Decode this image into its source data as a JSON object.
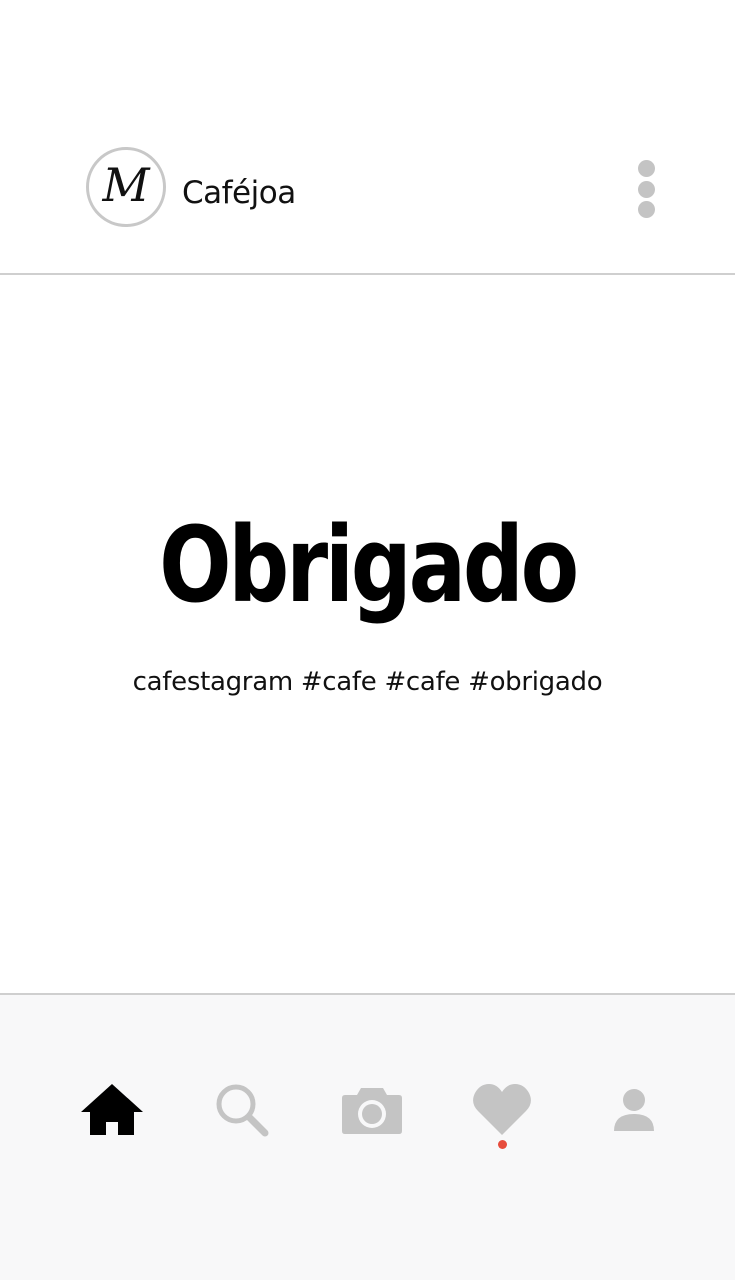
{
  "header": {
    "avatar_letter": "M",
    "account_name": "Caféjoa",
    "more_icon": "more-vertical-icon"
  },
  "post": {
    "headline": "Obrigado",
    "caption": "cafestagram #cafe #cafe #obrigado"
  },
  "bottom_nav": {
    "items": [
      {
        "icon": "home-icon",
        "active": true
      },
      {
        "icon": "search-icon",
        "active": false
      },
      {
        "icon": "camera-icon",
        "active": false
      },
      {
        "icon": "heart-icon",
        "active": false,
        "notification": true
      },
      {
        "icon": "user-icon",
        "active": false
      }
    ]
  },
  "colors": {
    "active_icon": "#000000",
    "inactive_icon": "#c4c4c4",
    "notification_dot": "#e74c3c",
    "divider": "#cfcfcf",
    "nav_background": "#f8f8f9"
  }
}
